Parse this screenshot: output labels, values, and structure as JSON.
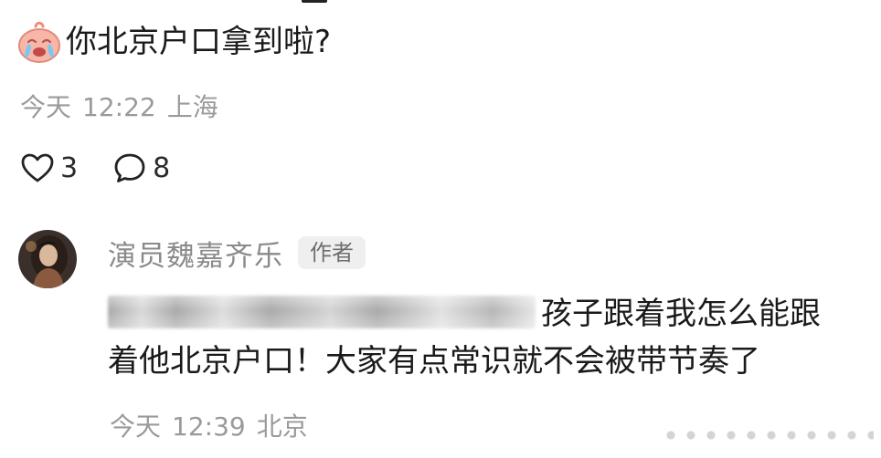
{
  "post": {
    "question_emoji": "crying-face-icon",
    "question_text": "你北京户口拿到啦?",
    "date": "今天",
    "time": "12:22",
    "location": "上海",
    "likes": "3",
    "comments": "8"
  },
  "reply": {
    "avatar": "author-avatar",
    "author_name": "演员魏嘉齐乐",
    "author_badge": "作者",
    "text_line1_visible": "孩子跟着我怎么能跟",
    "text_line2": "着他北京户口！大家有点常识就不会被带节奏了",
    "date": "今天",
    "time": "12:39",
    "location": "北京"
  },
  "colors": {
    "meta_text": "#9a9a9a",
    "author_name": "#8a8a8a",
    "badge_bg": "#efefef",
    "body_text": "#1a1a1a"
  }
}
